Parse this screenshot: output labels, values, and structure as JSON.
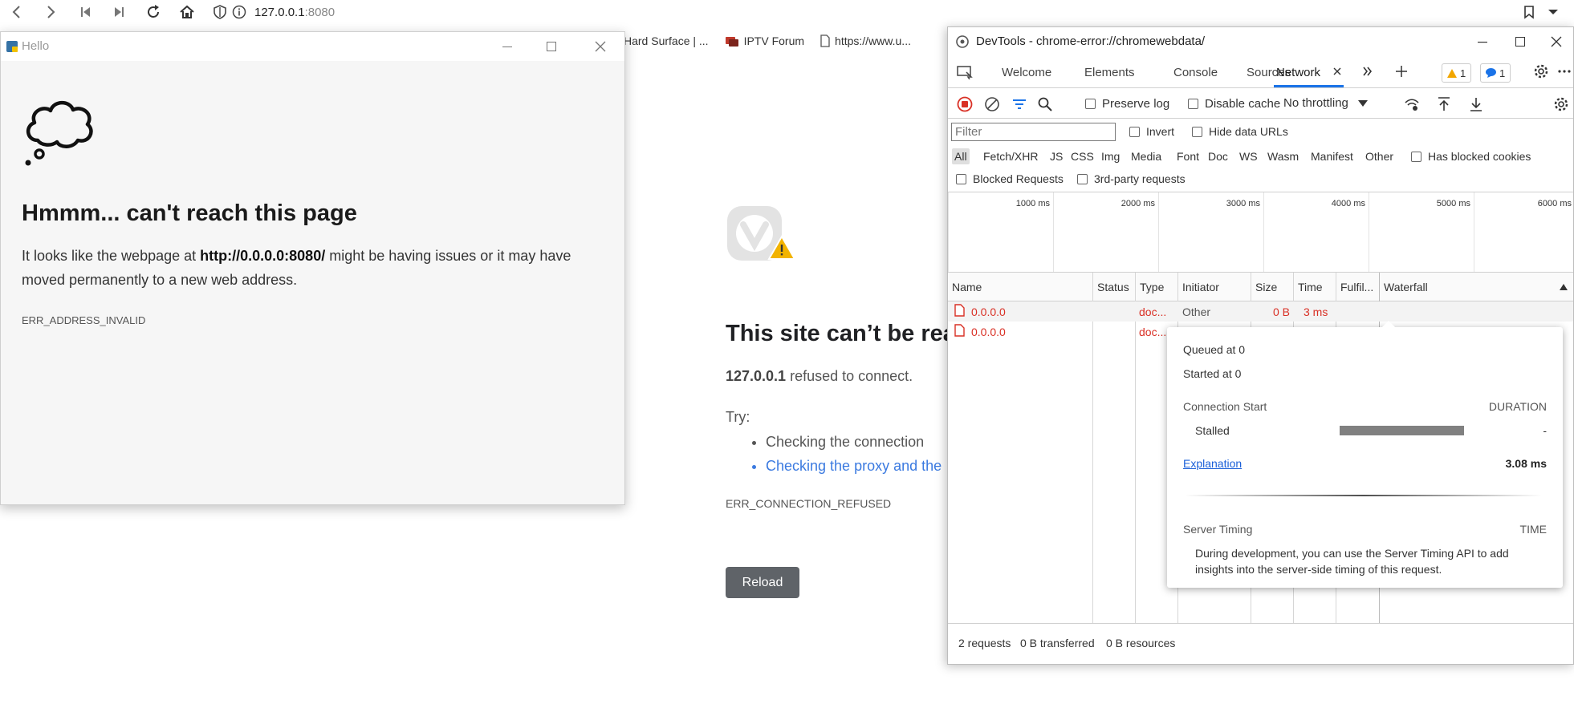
{
  "browser": {
    "url_host": "127.0.0.1",
    "url_port": ":8080",
    "bookmarks": [
      {
        "label": "Hard Surface | ...",
        "icon": "bookmark-icon"
      },
      {
        "label": "IPTV Forum",
        "icon": "forum-icon"
      },
      {
        "label": "https://www.u...",
        "icon": "page-icon"
      }
    ]
  },
  "vivaldi_error": {
    "heading": "This site can’t be rea",
    "host": "127.0.0.1",
    "refused_text": " refused to connect.",
    "try_label": "Try:",
    "suggestions": [
      "Checking the connection",
      "Checking the proxy and the"
    ],
    "error_code": "ERR_CONNECTION_REFUSED",
    "reload_label": "Reload"
  },
  "hello_window": {
    "title": "Hello",
    "heading": "Hmmm... can't reach this page",
    "desc_prefix": "It looks like the webpage at ",
    "desc_url": "http://0.0.0.0:8080/",
    "desc_suffix": " might be having issues or it may have moved permanently to a new web address.",
    "error_code": "ERR_ADDRESS_INVALID"
  },
  "devtools": {
    "title": "DevTools - chrome-error://chromewebdata/",
    "tabs": [
      "Welcome",
      "Elements",
      "Console",
      "Sources",
      "Network"
    ],
    "active_tab": "Network",
    "warning_count": "1",
    "message_count": "1",
    "toolbar": {
      "preserve_log": "Preserve log",
      "disable_cache": "Disable cache",
      "throttling": "No throttling"
    },
    "filter": {
      "placeholder": "Filter",
      "invert": "Invert",
      "hide_data_urls": "Hide data URLs",
      "types": [
        "All",
        "Fetch/XHR",
        "JS",
        "CSS",
        "Img",
        "Media",
        "Font",
        "Doc",
        "WS",
        "Wasm",
        "Manifest",
        "Other"
      ],
      "has_blocked_cookies": "Has blocked cookies",
      "blocked_requests": "Blocked Requests",
      "third_party": "3rd-party requests"
    },
    "timeline_ticks": [
      "1000 ms",
      "2000 ms",
      "3000 ms",
      "4000 ms",
      "5000 ms",
      "6000 ms"
    ],
    "columns": [
      "Name",
      "Status",
      "Type",
      "Initiator",
      "Size",
      "Time",
      "Fulfil...",
      "Waterfall"
    ],
    "requests": [
      {
        "name": "0.0.0.0",
        "status": "",
        "type": "doc...",
        "initiator": "Other",
        "size": "0 B",
        "time": "3 ms"
      },
      {
        "name": "0.0.0.0",
        "status": "",
        "type": "doc...",
        "initiator": "",
        "size": "",
        "time": ""
      }
    ],
    "status_bar": {
      "requests": "2 requests",
      "transferred": "0 B transferred",
      "resources": "0 B resources"
    },
    "timing": {
      "queued": "Queued at 0",
      "started": "Started at 0",
      "connection_start": "Connection Start",
      "duration_label": "DURATION",
      "stalled_label": "Stalled",
      "stalled_value": "-",
      "explanation": "Explanation",
      "total": "3.08 ms",
      "server_timing": "Server Timing",
      "time_label": "TIME",
      "server_timing_note": "During development, you can use the Server Timing API to add insights into the server-side timing of this request."
    }
  }
}
